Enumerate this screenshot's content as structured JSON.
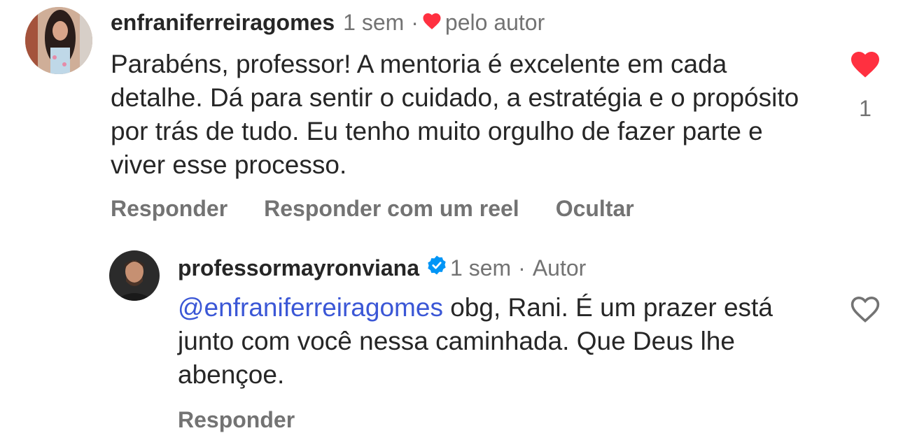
{
  "comment": {
    "username": "enfraniferreiragomes",
    "time": "1 sem",
    "separator": "·",
    "liked_by_author": "pelo autor",
    "text": "Parabéns, professor! A mentoria é excelente em cada detalhe. Dá para sentir o cuidado, a estratégia e o propósito por trás de tudo. Eu tenho muito orgulho de fazer parte e viver esse processo.",
    "like_count": "1",
    "liked": true,
    "actions": {
      "reply": "Responder",
      "reply_reel": "Responder com um reel",
      "hide": "Ocultar"
    }
  },
  "reply": {
    "username": "professormayronviana",
    "verified": true,
    "time": "1 sem",
    "separator": "·",
    "author_badge": "Autor",
    "mention": "@enfraniferreiragomes",
    "text": " obg, Rani. É um prazer está junto com você nessa caminhada. Que Deus lhe abençoe.",
    "liked": false,
    "actions": {
      "reply": "Responder"
    }
  },
  "colors": {
    "like_red": "#ff3040",
    "verified_blue": "#0095f6",
    "mention_blue": "#3b57d6",
    "secondary_text": "#737373"
  }
}
